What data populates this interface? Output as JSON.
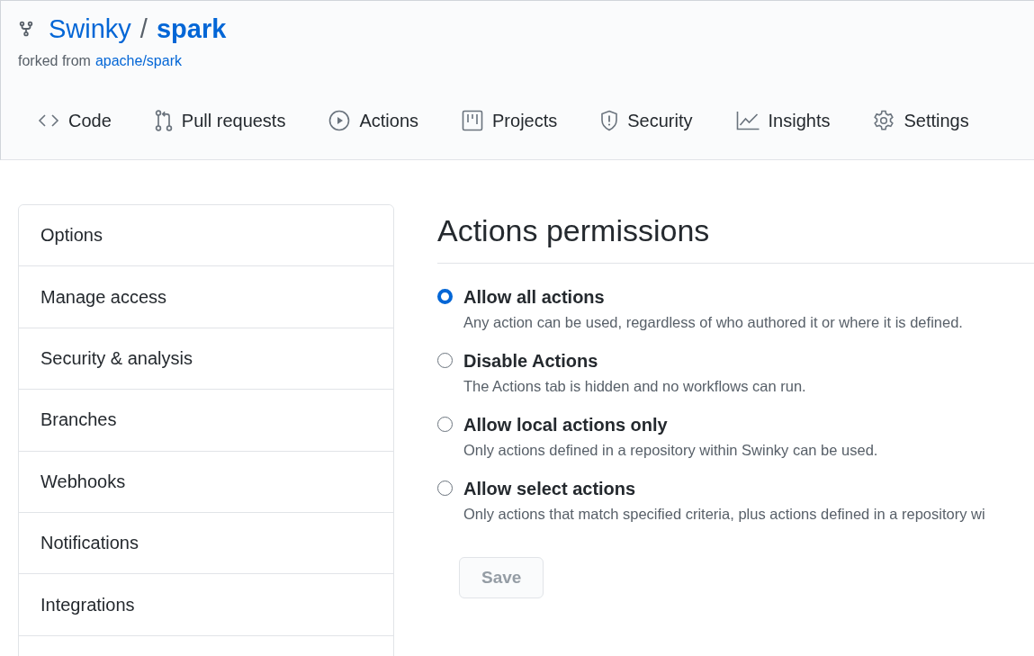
{
  "repo": {
    "owner": "Swinky",
    "separator": "/",
    "name": "spark",
    "forked_from_label": "forked from",
    "forked_from": "apache/spark"
  },
  "tabs": [
    {
      "label": "Code",
      "kind": "code",
      "selected": false
    },
    {
      "label": "Pull requests",
      "kind": "pull",
      "selected": false
    },
    {
      "label": "Actions",
      "kind": "play",
      "selected": false
    },
    {
      "label": "Projects",
      "kind": "project",
      "selected": false
    },
    {
      "label": "Security",
      "kind": "shield",
      "selected": false
    },
    {
      "label": "Insights",
      "kind": "graph",
      "selected": false
    },
    {
      "label": "Settings",
      "kind": "gear",
      "selected": false
    }
  ],
  "sidebar": {
    "items": [
      {
        "label": "Options",
        "selected": false
      },
      {
        "label": "Manage access",
        "selected": false
      },
      {
        "label": "Security & analysis",
        "selected": false
      },
      {
        "label": "Branches",
        "selected": false
      },
      {
        "label": "Webhooks",
        "selected": false
      },
      {
        "label": "Notifications",
        "selected": false
      },
      {
        "label": "Integrations",
        "selected": false
      }
    ]
  },
  "main": {
    "heading": "Actions permissions",
    "options": [
      {
        "title": "Allow all actions",
        "description": "Any action can be used, regardless of who authored it or where it is defined.",
        "selected": true
      },
      {
        "title": "Disable Actions",
        "description": "The Actions tab is hidden and no workflows can run.",
        "selected": false
      },
      {
        "title": "Allow local actions only",
        "description": "Only actions defined in a repository within Swinky can be used.",
        "selected": false
      },
      {
        "title": "Allow select actions",
        "description": "Only actions that match specified criteria, plus actions defined in a repository wi",
        "selected": false
      }
    ],
    "save_button": {
      "label": "Save",
      "disabled": true
    }
  }
}
